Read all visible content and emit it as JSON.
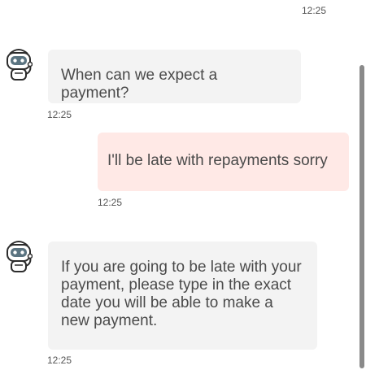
{
  "messages": [
    {
      "role": "user",
      "time": "12:25"
    },
    {
      "role": "bot",
      "text": "When can we expect a payment?",
      "time": "12:25"
    },
    {
      "role": "user",
      "text": "I'll be late with repayments sorry",
      "time": "12:25"
    },
    {
      "role": "bot",
      "text": "If you are going to be late with your payment, please type in the exact date you will be able to make a new payment.",
      "time": "12:25"
    }
  ],
  "avatar_icon": "robot-icon",
  "colors": {
    "bot_bubble": "#f3f3f3",
    "user_bubble": "#ffe9e6",
    "text": "#4a4a4a",
    "scrollbar": "#8a8a8a"
  }
}
